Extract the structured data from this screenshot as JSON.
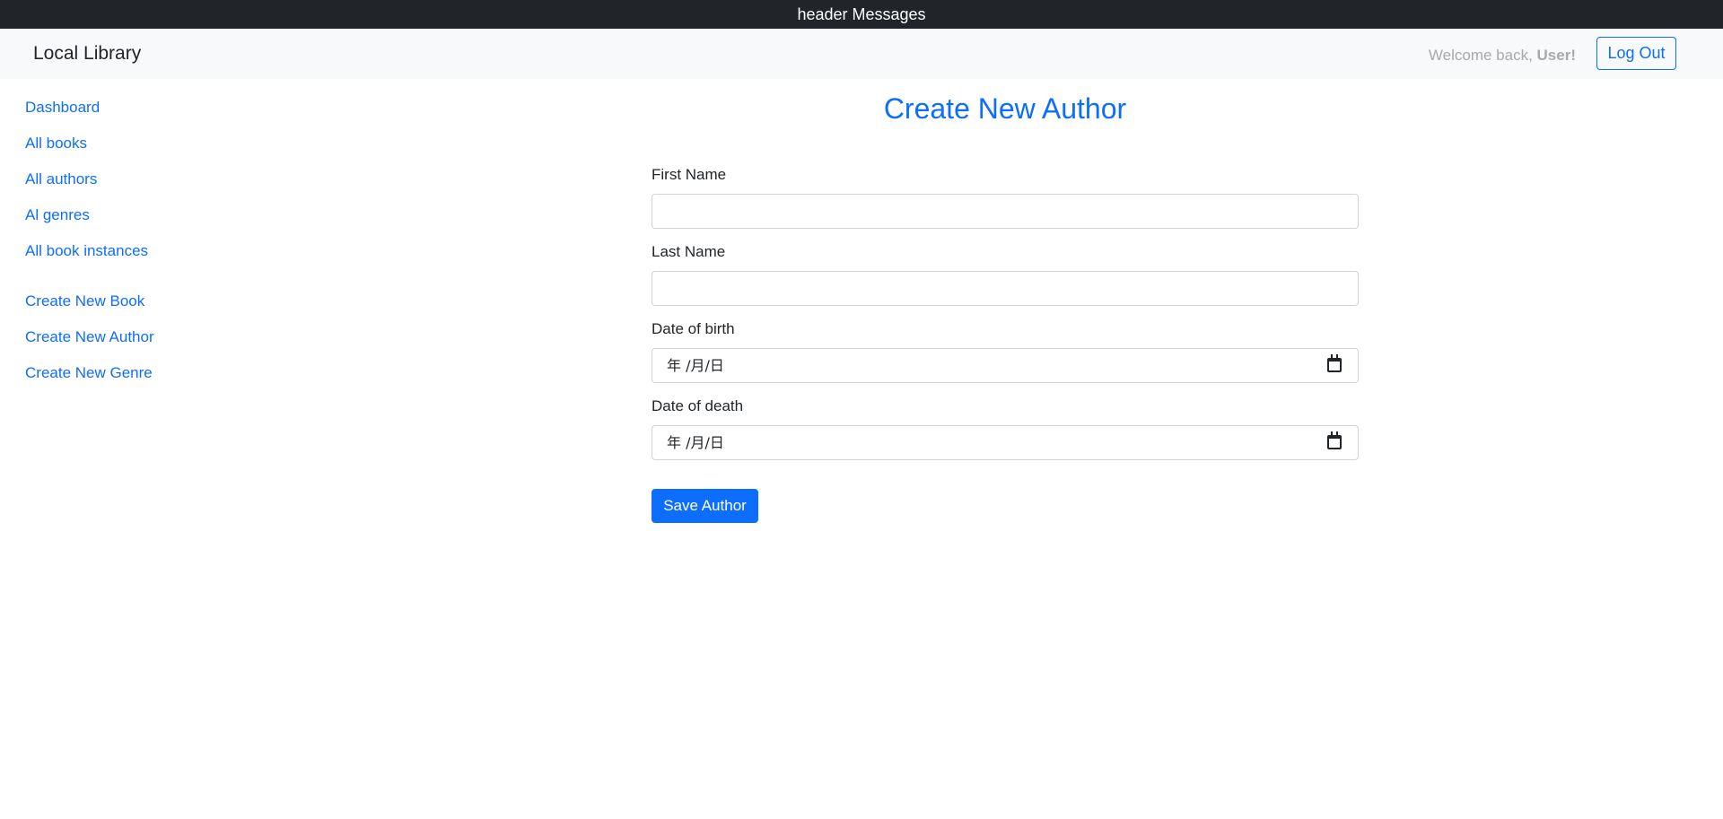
{
  "topbar": {
    "text": "header Messages"
  },
  "navbar": {
    "brand": "Local Library",
    "welcome_prefix": "Welcome back, ",
    "user_name": "User!",
    "logout_label": "Log Out"
  },
  "sidebar": {
    "items": [
      {
        "label": "Dashboard"
      },
      {
        "label": "All books"
      },
      {
        "label": "All authors"
      },
      {
        "label": "Al genres"
      },
      {
        "label": "All book instances"
      }
    ],
    "create_items": [
      {
        "label": "Create New Book"
      },
      {
        "label": "Create New Author"
      },
      {
        "label": "Create New Genre"
      }
    ]
  },
  "main": {
    "title": "Create New Author",
    "fields": {
      "first_name": {
        "label": "First Name",
        "value": ""
      },
      "last_name": {
        "label": "Last Name",
        "value": ""
      },
      "date_of_birth": {
        "label": "Date of birth",
        "placeholder": "年 /月/日"
      },
      "date_of_death": {
        "label": "Date of death",
        "placeholder": "年 /月/日"
      }
    },
    "save_label": "Save Author"
  },
  "colors": {
    "accent": "#0d6efd",
    "topbar_bg": "#212529",
    "navbar_bg": "#f8f9fa"
  },
  "icons": {
    "date_picker": "calendar-icon"
  }
}
